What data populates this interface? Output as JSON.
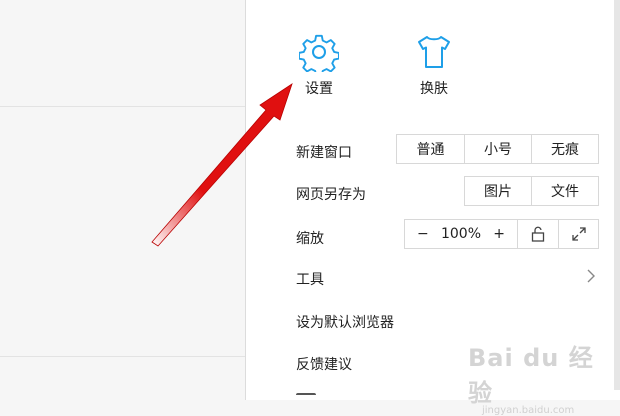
{
  "top": {
    "settings_label": "设置",
    "skin_label": "换肤"
  },
  "rows": {
    "new_window": {
      "label": "新建窗口",
      "options": [
        "普通",
        "小号",
        "无痕"
      ]
    },
    "save_as": {
      "label": "网页另存为",
      "options": [
        "图片",
        "文件"
      ]
    },
    "zoom": {
      "label": "缩放",
      "minus": "−",
      "value": "100%",
      "plus": "+"
    },
    "tools": {
      "label": "工具"
    },
    "default_browser": {
      "label": "设为默认浏览器"
    },
    "feedback": {
      "label": "反馈建议"
    }
  },
  "watermark": {
    "main": "Bai du 经验",
    "sub": "jingyan.baidu.com"
  },
  "icons": {
    "settings": "gear-icon",
    "skin": "tshirt-icon",
    "lock": "unlock-icon",
    "fullscreen": "expand-icon",
    "submenu": "chevron-right-icon",
    "annotation": "red-arrow"
  },
  "colors": {
    "accent": "#1e9fe8",
    "annotation_arrow": "#e01010"
  }
}
